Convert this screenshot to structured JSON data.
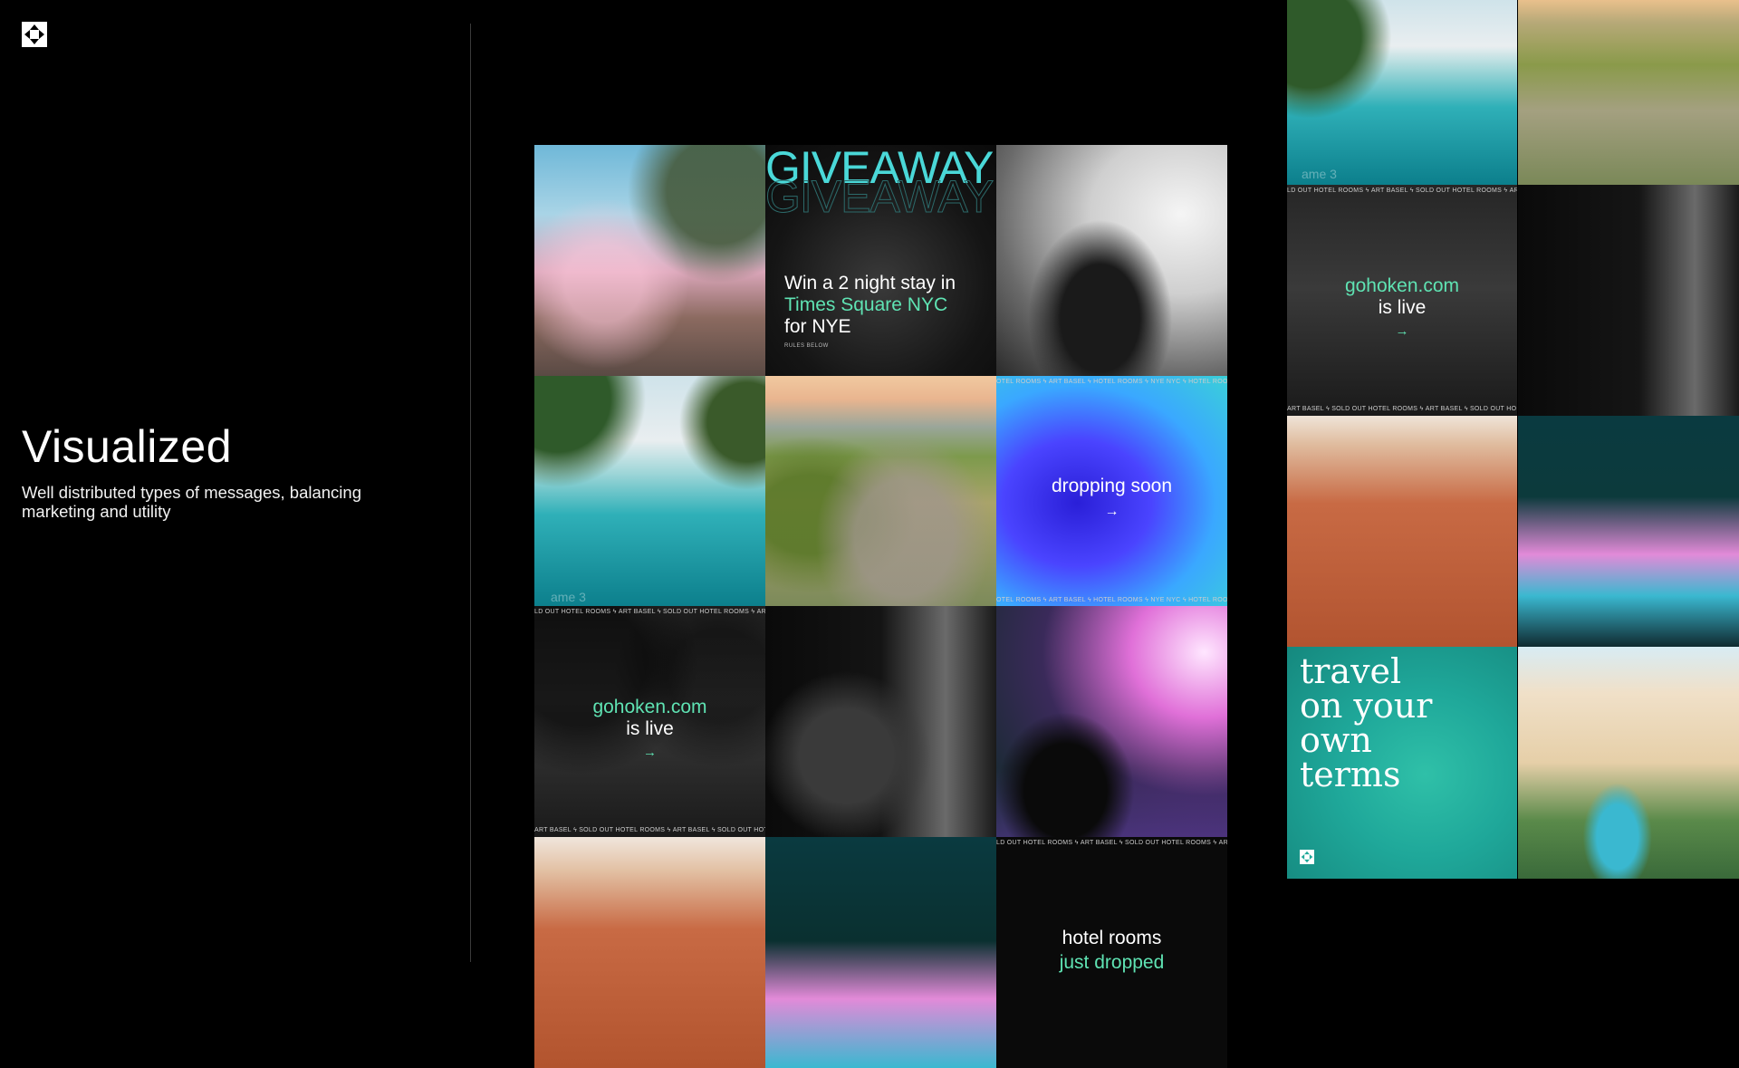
{
  "hero": {
    "title": "Visualized",
    "subtitle": "Well distributed types of messages, balancing marketing and utility"
  },
  "icons": {
    "logo": "hoken-logo-icon",
    "arrow": "→",
    "bolt": "ϟ"
  },
  "colors": {
    "background": "#000000",
    "accent": "#5fe3b3",
    "gradient_blue": "#3a2cff",
    "teal": "#1fa89a"
  },
  "tiles": {
    "giveaway": {
      "headline": "GIVEAWAY",
      "line1": "Win a 2 night stay in",
      "line2": "Times Square NYC",
      "line3": "for NYE",
      "fine_print": "RULES BELOW"
    },
    "dropping": {
      "line1": "dropping soon",
      "arrow": "→",
      "ticker": "OTEL ROOMS ϟ ART BASEL ϟ HOTEL ROOMS ϟ NYE NYC ϟ HOTEL ROO"
    },
    "gohoken_main": {
      "line1": "gohoken.com",
      "line2": "is live",
      "arrow": "→",
      "ticker_top": "LD OUT HOTEL ROOMS ϟ ART BASEL ϟ SOLD OUT HOTEL ROOMS ϟ AR",
      "ticker_bottom": "ART BASEL ϟ SOLD OUT HOTEL ROOMS ϟ ART BASEL ϟ SOLD OUT HOT",
      "frame_label": "ame 3"
    },
    "hotel_rooms": {
      "line1": "hotel rooms",
      "line2": "just dropped",
      "ticker": "LD OUT HOTEL ROOMS ϟ ART BASEL ϟ SOLD OUT HOTEL ROOMS ϟ AR"
    },
    "gohoken_side": {
      "line1": "gohoken.com",
      "line2": "is live",
      "arrow": "→",
      "ticker_top": "LD OUT HOTEL ROOMS ϟ ART BASEL ϟ SOLD OUT HOTEL ROOMS ϟ AR",
      "ticker_bottom": "ART BASEL ϟ SOLD OUT HOTEL ROOMS ϟ ART BASEL ϟ SOLD OUT HO",
      "frame_label": "ame 3"
    },
    "travel": {
      "line1": "travel",
      "line2": "on your",
      "line3": "own",
      "line4": "terms"
    }
  }
}
